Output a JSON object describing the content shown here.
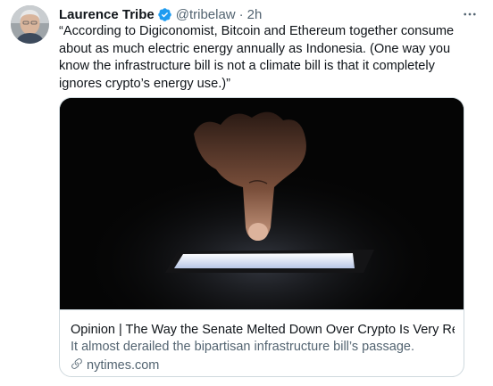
{
  "tweet": {
    "author_name": "Laurence Tribe",
    "handle": "@tribelaw",
    "separator": "·",
    "time": "2h",
    "text": "“According to Digiconomist, Bitcoin and Ethereum together consume about as much electric energy annually as Indonesia. (One way you know the infrastructure bill is not a climate bill is that it completely ignores crypto’s energy use.)”",
    "icons": {
      "verified": "verified-badge-icon",
      "more": "more-dots-icon",
      "link": "link-icon"
    },
    "colors": {
      "verified": "#1d9bf0",
      "secondary_text": "#536471",
      "border": "#cfd9de"
    }
  },
  "card": {
    "title": "Opinion | The Way the Senate Melted Down Over Crypto Is Very Revea...",
    "description": "It almost derailed the bipartisan infrastructure bill’s passage.",
    "domain": "nytimes.com"
  }
}
